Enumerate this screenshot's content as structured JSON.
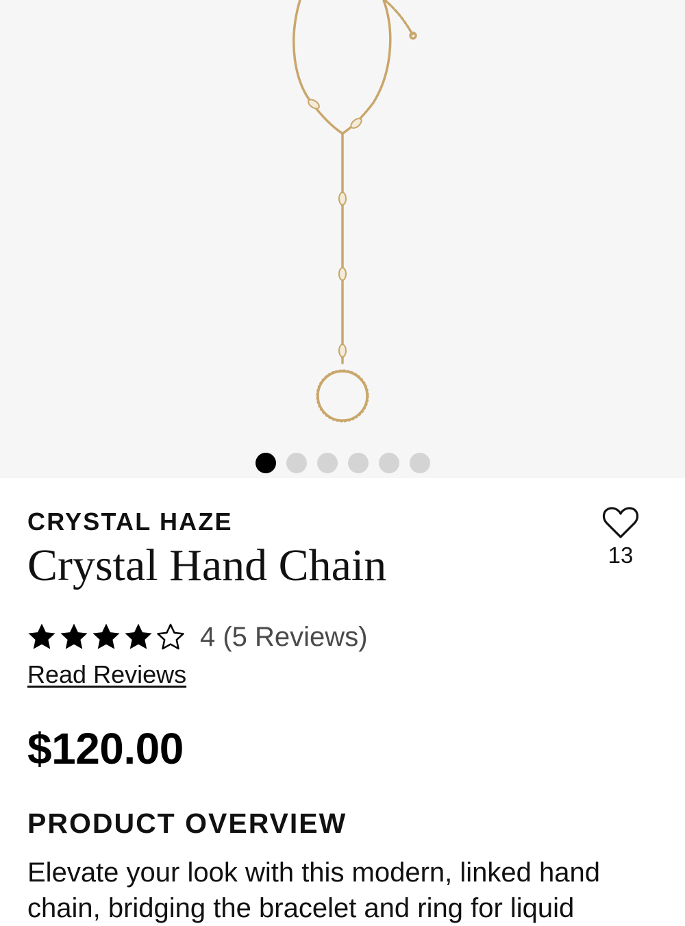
{
  "gallery": {
    "image_alt": "Gold hand chain with crystals",
    "slide_count": 6,
    "active_slide": 1
  },
  "product": {
    "brand": "CRYSTAL HAZE",
    "name": "Crystal Hand Chain",
    "favorites_count": "13",
    "rating": 4,
    "rating_max": 5,
    "rating_text": "4 (5 Reviews)",
    "read_reviews_label": "Read Reviews",
    "price": "$120.00"
  },
  "overview": {
    "heading": "PRODUCT OVERVIEW",
    "text": "Elevate your look with this modern, linked hand chain, bridging the bracelet and ring for liquid"
  },
  "colors": {
    "gallery_bg": "#f6f6f7",
    "gold": "#c9a66b",
    "dot_active": "#000000",
    "dot_inactive": "#d4d4d4"
  },
  "icons": {
    "favorite": "heart-outline-icon",
    "star_full": "star-filled-icon",
    "star_empty": "star-outline-icon"
  }
}
